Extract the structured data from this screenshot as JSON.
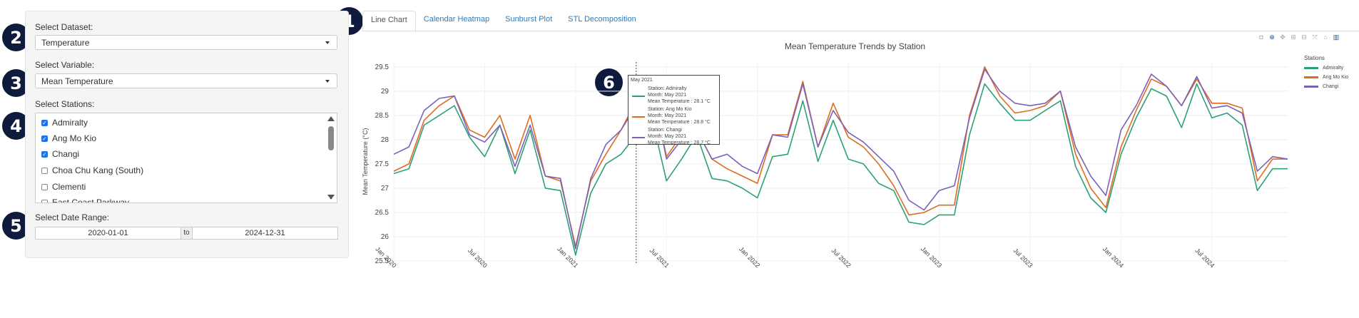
{
  "markers": [
    "1",
    "2",
    "3",
    "4",
    "5",
    "6"
  ],
  "sidebar": {
    "dataset_label": "Select Dataset:",
    "dataset_value": "Temperature",
    "variable_label": "Select Variable:",
    "variable_value": "Mean Temperature",
    "stations_label": "Select Stations:",
    "stations": [
      {
        "name": "Admiralty",
        "checked": true
      },
      {
        "name": "Ang Mo Kio",
        "checked": true
      },
      {
        "name": "Changi",
        "checked": true
      },
      {
        "name": "Choa Chu Kang (South)",
        "checked": false
      },
      {
        "name": "Clementi",
        "checked": false
      },
      {
        "name": "East Coast Parkway",
        "checked": false
      }
    ],
    "date_label": "Select Date Range:",
    "date_start": "2020-01-01",
    "date_sep": "to",
    "date_end": "2024-12-31"
  },
  "tabs": [
    "Line Chart",
    "Calendar Heatmap",
    "Sunburst Plot",
    "STL Decomposition"
  ],
  "active_tab": "Line Chart",
  "modebar_icons": [
    "camera-icon",
    "zoom-icon",
    "pan-icon",
    "zoom-in-icon",
    "zoom-out-icon",
    "autoscale-icon",
    "home-icon",
    "plotly-logo-icon"
  ],
  "tooltip": {
    "header": "May 2021",
    "entries": [
      {
        "station": "Station: Admiralty",
        "month": "Month: May 2021",
        "value": "Mean Temperature : 28.1 °C"
      },
      {
        "station": "Station: Ang Mo Kio",
        "month": "Month: May 2021",
        "value": "Mean Temperature : 28.8 °C"
      },
      {
        "station": "Station: Changi",
        "month": "Month: May 2021",
        "value": "Mean Temperature : 28.7 °C"
      }
    ]
  },
  "chart_data": {
    "type": "line",
    "title": "Mean Temperature Trends by Station",
    "xlabel": "",
    "ylabel": "Mean Temperature (°C)",
    "ylim": [
      25.5,
      29.6
    ],
    "yticks": [
      25.5,
      26,
      26.5,
      27,
      27.5,
      28,
      28.5,
      29,
      29.5
    ],
    "xtick_labels": [
      "Jan 2020",
      "Jul 2020",
      "Jan 2021",
      "Jul 2021",
      "Jan 2022",
      "Jul 2022",
      "Jan 2023",
      "Jul 2023",
      "Jan 2024",
      "Jul 2024"
    ],
    "x": [
      "2020-01",
      "2020-02",
      "2020-03",
      "2020-04",
      "2020-05",
      "2020-06",
      "2020-07",
      "2020-08",
      "2020-09",
      "2020-10",
      "2020-11",
      "2020-12",
      "2021-01",
      "2021-02",
      "2021-03",
      "2021-04",
      "2021-05",
      "2021-06",
      "2021-07",
      "2021-08",
      "2021-09",
      "2021-10",
      "2021-11",
      "2021-12",
      "2022-01",
      "2022-02",
      "2022-03",
      "2022-04",
      "2022-05",
      "2022-06",
      "2022-07",
      "2022-08",
      "2022-09",
      "2022-10",
      "2022-11",
      "2022-12",
      "2023-01",
      "2023-02",
      "2023-03",
      "2023-04",
      "2023-05",
      "2023-06",
      "2023-07",
      "2023-08",
      "2023-09",
      "2023-10",
      "2023-11",
      "2023-12",
      "2024-01",
      "2024-02",
      "2024-03",
      "2024-04",
      "2024-05",
      "2024-06",
      "2024-07",
      "2024-08",
      "2024-09",
      "2024-10",
      "2024-11",
      "2024-12"
    ],
    "legend_title": "Stations",
    "legend_position": "right",
    "grid": true,
    "hover_x": "2021-05",
    "series": [
      {
        "name": "Admiralty",
        "color": "#2ca176",
        "values": [
          27.3,
          27.4,
          28.3,
          28.5,
          28.7,
          28.05,
          27.65,
          28.3,
          27.3,
          28.2,
          27.0,
          26.95,
          25.62,
          26.9,
          27.5,
          27.7,
          28.1,
          28.5,
          27.15,
          27.6,
          28.1,
          27.2,
          27.15,
          27.0,
          26.8,
          27.65,
          27.7,
          28.8,
          27.55,
          28.4,
          27.6,
          27.5,
          27.1,
          26.95,
          26.3,
          26.25,
          26.45,
          26.45,
          28.1,
          29.15,
          28.75,
          28.4,
          28.4,
          28.6,
          28.8,
          27.45,
          26.8,
          26.5,
          27.7,
          28.45,
          29.05,
          28.9,
          28.25,
          29.15,
          28.45,
          28.55,
          28.3,
          26.95,
          27.4,
          27.4
        ]
      },
      {
        "name": "Ang Mo Kio",
        "color": "#e06b1f",
        "values": [
          27.35,
          27.5,
          28.4,
          28.7,
          28.9,
          28.2,
          28.05,
          28.5,
          27.6,
          28.5,
          27.25,
          27.15,
          25.8,
          27.15,
          27.7,
          28.2,
          28.8,
          29.1,
          27.65,
          28.1,
          28.2,
          27.6,
          27.4,
          27.25,
          27.1,
          28.1,
          28.1,
          29.2,
          27.85,
          28.75,
          28.05,
          27.85,
          27.5,
          27.05,
          26.45,
          26.5,
          26.65,
          26.65,
          28.5,
          29.5,
          28.9,
          28.55,
          28.6,
          28.7,
          29.0,
          27.7,
          27.0,
          26.6,
          27.85,
          28.6,
          29.25,
          29.1,
          28.7,
          29.25,
          28.75,
          28.75,
          28.65,
          27.15,
          27.6,
          27.6
        ]
      },
      {
        "name": "Changi",
        "color": "#7b62b8",
        "values": [
          27.7,
          27.85,
          28.6,
          28.85,
          28.9,
          28.1,
          27.95,
          28.3,
          27.45,
          28.3,
          27.25,
          27.2,
          25.75,
          27.2,
          27.9,
          28.2,
          28.7,
          29.15,
          27.6,
          28.0,
          28.2,
          27.6,
          27.7,
          27.45,
          27.3,
          28.1,
          28.05,
          29.15,
          27.85,
          28.6,
          28.15,
          27.95,
          27.65,
          27.35,
          26.75,
          26.55,
          26.95,
          27.05,
          28.45,
          29.45,
          29.0,
          28.75,
          28.7,
          28.75,
          29.0,
          27.85,
          27.25,
          26.85,
          28.2,
          28.7,
          29.35,
          29.1,
          28.7,
          29.3,
          28.65,
          28.7,
          28.55,
          27.35,
          27.65,
          27.6
        ]
      }
    ]
  }
}
